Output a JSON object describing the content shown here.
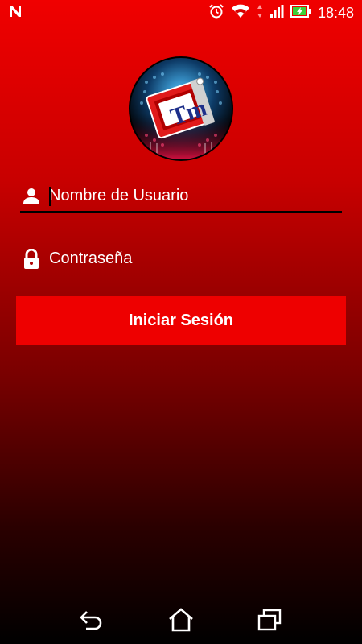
{
  "status_bar": {
    "time": "18:48",
    "icons": [
      "notification-n-icon",
      "alarm-icon",
      "wifi-icon",
      "data-arrows-icon",
      "signal-icon",
      "battery-charging-icon"
    ]
  },
  "logo": {
    "text": "Tm"
  },
  "form": {
    "username_placeholder": "Nombre de Usuario",
    "password_placeholder": "Contraseña",
    "username_value": "",
    "password_value": "",
    "submit_label": "Iniciar Sesión"
  },
  "nav_bar": {
    "icons": [
      "back-icon",
      "home-icon",
      "recent-apps-icon"
    ]
  },
  "colors": {
    "gradient_top": "#f00000",
    "gradient_bottom": "#000000",
    "button": "#ee0000"
  }
}
